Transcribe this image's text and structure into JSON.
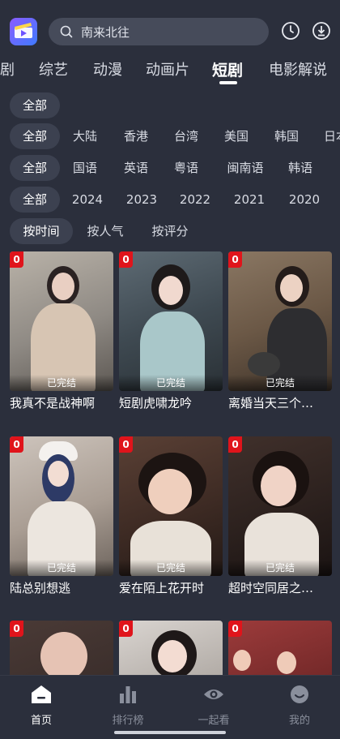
{
  "search": {
    "placeholder": "南来北往"
  },
  "categories": [
    {
      "label": "剧",
      "active": false
    },
    {
      "label": "综艺",
      "active": false
    },
    {
      "label": "动漫",
      "active": false
    },
    {
      "label": "动画片",
      "active": false
    },
    {
      "label": "短剧",
      "active": true
    },
    {
      "label": "电影解说",
      "active": false
    }
  ],
  "filters": {
    "row1": [
      "全部"
    ],
    "region": [
      "全部",
      "大陆",
      "香港",
      "台湾",
      "美国",
      "韩国",
      "日本"
    ],
    "language": [
      "全部",
      "国语",
      "英语",
      "粤语",
      "闽南语",
      "韩语"
    ],
    "year": [
      "全部",
      "2024",
      "2023",
      "2022",
      "2021",
      "2020"
    ],
    "sort": [
      "按时间",
      "按人气",
      "按评分"
    ]
  },
  "cards": [
    {
      "badge": "0",
      "status": "已完结",
      "title": "我真不是战神啊"
    },
    {
      "badge": "0",
      "status": "已完结",
      "title": "短剧虎啸龙吟"
    },
    {
      "badge": "0",
      "status": "已完结",
      "title": "离婚当天三个…"
    },
    {
      "badge": "0",
      "status": "已完结",
      "title": "陆总别想逃"
    },
    {
      "badge": "0",
      "status": "已完结",
      "title": "爱在陌上花开时"
    },
    {
      "badge": "0",
      "status": "已完结",
      "title": "超时空同居之…"
    },
    {
      "badge": "0",
      "status": "",
      "title": ""
    },
    {
      "badge": "0",
      "status": "",
      "title": ""
    },
    {
      "badge": "0",
      "status": "",
      "title": ""
    }
  ],
  "tabs": [
    {
      "label": "首页",
      "icon": "home-icon",
      "active": true
    },
    {
      "label": "排行榜",
      "icon": "bar-chart-icon",
      "active": false
    },
    {
      "label": "一起看",
      "icon": "eye-icon",
      "active": false
    },
    {
      "label": "我的",
      "icon": "smile-face-icon",
      "active": false
    }
  ],
  "colors": {
    "background": "#2b2f3c",
    "badge": "#e0141b",
    "chip_selected": "#3c4150"
  }
}
